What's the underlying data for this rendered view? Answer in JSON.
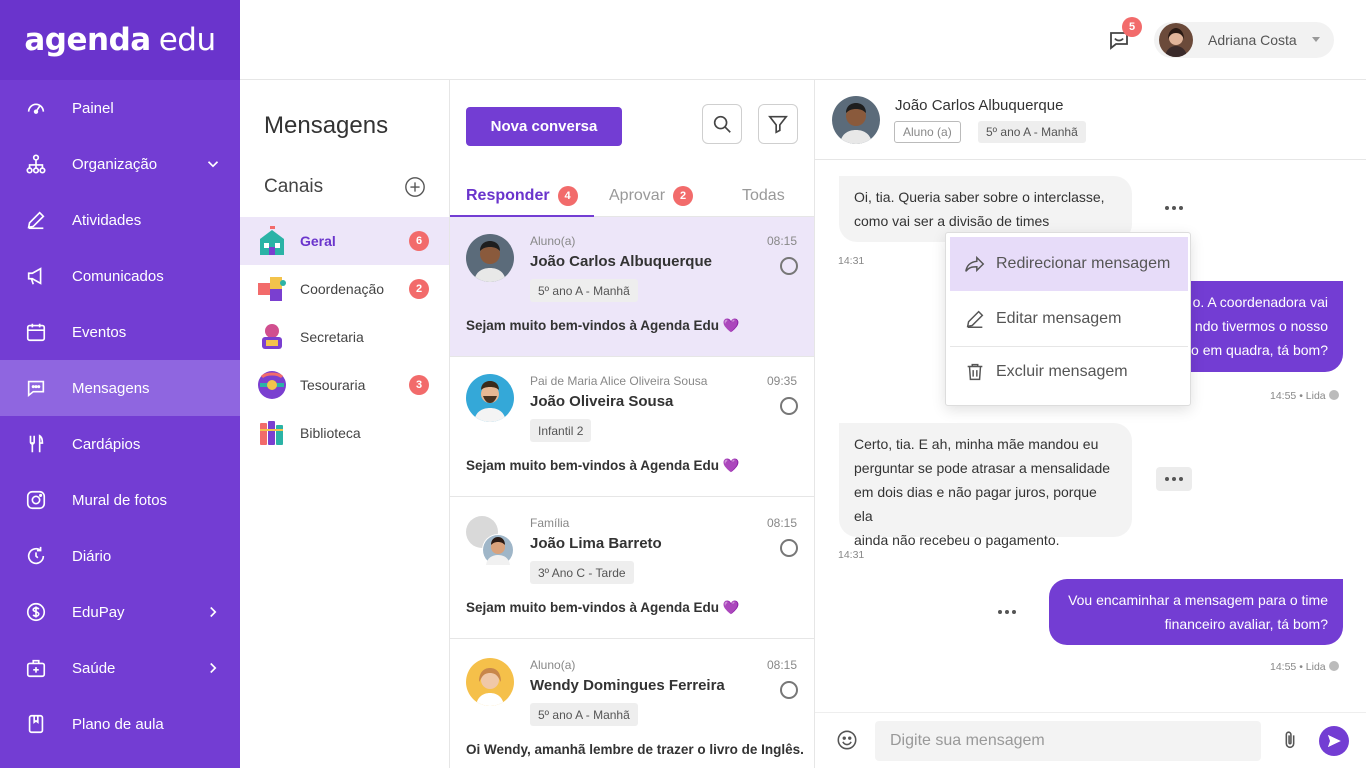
{
  "logo": {
    "bold": "agenda",
    "light": "edu"
  },
  "colors": {
    "primary": "#733dd3",
    "primary_dark": "#6a34cc",
    "badge": "#f26b6b",
    "active_bg": "#ede6f9"
  },
  "sidebar": {
    "items": [
      {
        "label": "Painel",
        "icon": "dashboard-icon"
      },
      {
        "label": "Organização",
        "icon": "organization-icon",
        "chevron": "down"
      },
      {
        "label": "Atividades",
        "icon": "pencil-icon"
      },
      {
        "label": "Comunicados",
        "icon": "megaphone-icon"
      },
      {
        "label": "Eventos",
        "icon": "calendar-icon"
      },
      {
        "label": "Mensagens",
        "icon": "chat-icon",
        "active": true
      },
      {
        "label": "Cardápios",
        "icon": "cutlery-icon"
      },
      {
        "label": "Mural de fotos",
        "icon": "camera-icon"
      },
      {
        "label": "Diário",
        "icon": "refresh-icon"
      },
      {
        "label": "EduPay",
        "icon": "dollar-icon",
        "chevron": "right"
      },
      {
        "label": "Saúde",
        "icon": "health-icon",
        "chevron": "right"
      },
      {
        "label": "Plano de aula",
        "icon": "notebook-icon"
      }
    ]
  },
  "topbar": {
    "notification_count": "5",
    "user_name": "Adriana Costa"
  },
  "channels": {
    "title": "Mensagens",
    "subtitle": "Canais",
    "items": [
      {
        "label": "Geral",
        "badge": "6",
        "active": true
      },
      {
        "label": "Coordenação",
        "badge": "2"
      },
      {
        "label": "Secretaria",
        "badge": ""
      },
      {
        "label": "Tesouraria",
        "badge": "3"
      },
      {
        "label": "Biblioteca",
        "badge": ""
      }
    ]
  },
  "conversations": {
    "new_button": "Nova conversa",
    "tabs": [
      {
        "label": "Responder",
        "badge": "4",
        "active": true
      },
      {
        "label": "Aprovar",
        "badge": "2"
      },
      {
        "label": "Todas",
        "badge": ""
      }
    ],
    "items": [
      {
        "role": "Aluno(a)",
        "name": "João Carlos Albuquerque",
        "time": "08:15",
        "tag": "5º ano A - Manhã",
        "message": "Sejam muito bem-vindos à Agenda Edu",
        "emoji": "💜",
        "active": true
      },
      {
        "role": "Pai de Maria Alice Oliveira Sousa",
        "name": "João Oliveira Sousa",
        "time": "09:35",
        "tag": "Infantil 2",
        "message": "Sejam muito bem-vindos à Agenda Edu",
        "emoji": "💜"
      },
      {
        "role": "Família",
        "name": "João Lima Barreto",
        "time": "08:15",
        "tag": "3º Ano C - Tarde",
        "message": "Sejam muito bem-vindos à Agenda Edu",
        "emoji": "💜"
      },
      {
        "role": "Aluno(a)",
        "name": "Wendy Domingues Ferreira",
        "time": "08:15",
        "tag": "5º ano A - Manhã",
        "message": "Oi Wendy, amanhã lembre de trazer o livro de Inglês."
      }
    ]
  },
  "chat": {
    "name": "João Carlos Albuquerque",
    "role": "Aluno (a)",
    "class": "5º ano A - Manhã",
    "messages": [
      {
        "dir": "in",
        "lines": [
          "Oi, tia. Queria saber sobre o interclasse,",
          "como vai ser a divisão de times"
        ],
        "time": "14:31"
      },
      {
        "dir": "out",
        "lines": [
          "o. A coordenadora vai",
          "ndo tivermos o nosso",
          "to em quadra, tá bom?"
        ],
        "time": "14:55 • Lida"
      },
      {
        "dir": "in",
        "lines": [
          "Certo, tia. E ah, minha mãe mandou eu",
          "perguntar se pode atrasar a mensalidade",
          "em dois dias e não pagar juros, porque ela",
          "ainda não recebeu o pagamento."
        ],
        "time": "14:31"
      },
      {
        "dir": "out",
        "lines": [
          "Vou encaminhar a mensagem para o time",
          "financeiro avaliar, tá bom?"
        ],
        "time": "14:55 • Lida"
      }
    ],
    "menu": {
      "items": [
        {
          "label": "Redirecionar mensagem",
          "icon": "forward-icon"
        },
        {
          "label": "Editar mensagem",
          "icon": "pencil-icon"
        },
        {
          "label": "Excluir mensagem",
          "icon": "trash-icon"
        }
      ]
    },
    "composer": {
      "placeholder": "Digite sua mensagem"
    }
  }
}
